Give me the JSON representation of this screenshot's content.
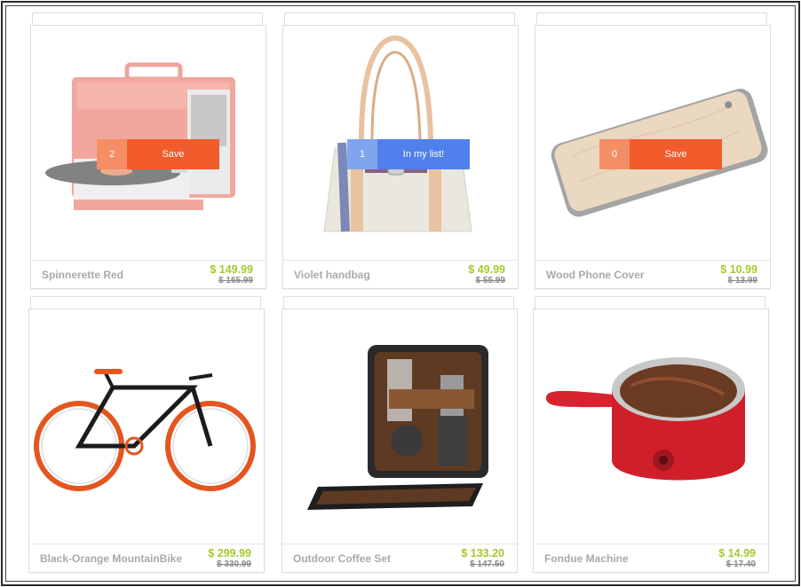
{
  "products": [
    {
      "name": "Spinnerette Red",
      "price": "$ 149.99",
      "old_price": "$ 165.99",
      "image": "record-player",
      "action": {
        "count": "2",
        "label": "Save"
      }
    },
    {
      "name": "Violet handbag",
      "price": "$ 49.99",
      "old_price": "$ 55.99",
      "image": "handbag",
      "action": {
        "count": "1",
        "label": "In my list!"
      }
    },
    {
      "name": "Wood Phone Cover",
      "price": "$ 10.99",
      "old_price": "$ 13.99",
      "image": "phone-cover",
      "action": {
        "count": "0",
        "label": "Save"
      }
    },
    {
      "name": "Black-Orange MountainBike",
      "price": "$ 299.99",
      "old_price": "$ 330.99",
      "image": "bicycle"
    },
    {
      "name": "Outdoor Coffee Set",
      "price": "$ 133.20",
      "old_price": "$ 147.50",
      "image": "coffee-set"
    },
    {
      "name": "Fondue Machine",
      "price": "$ 14.99",
      "old_price": "$ 17.40",
      "image": "fondue-machine"
    }
  ],
  "colors": {
    "price": "#a5c92c",
    "save_button": "#f25b2b",
    "list_button": "#4f80ec"
  }
}
